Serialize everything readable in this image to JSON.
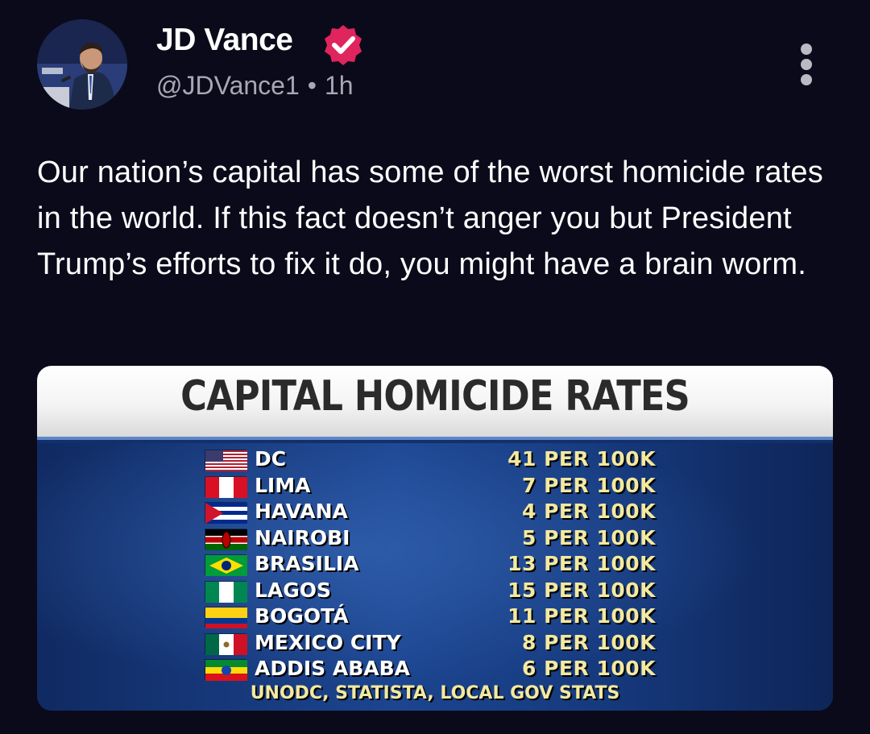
{
  "author": {
    "name": "JD Vance",
    "handle": "@JDVance1",
    "separator": "•",
    "time": "1h",
    "verified_color": "#e0245e"
  },
  "post": {
    "text": "Our nation’s capital has some of the worst homicide rates in the world. If this fact doesn’t anger you but President Trump’s efforts to fix it do, you might have a brain worm."
  },
  "menu_icon": "more-vertical-icon",
  "media": {
    "title": "CAPITAL HOMICIDE RATES",
    "rows": [
      {
        "city": "DC",
        "rate": "41 PER 100K",
        "flag": "flag-usa"
      },
      {
        "city": "LIMA",
        "rate": "7 PER 100K",
        "flag": "flag-peru"
      },
      {
        "city": "HAVANA",
        "rate": "4 PER 100K",
        "flag": "flag-cuba"
      },
      {
        "city": "NAIROBI",
        "rate": "5 PER 100K",
        "flag": "flag-kenya"
      },
      {
        "city": "BRASILIA",
        "rate": "13 PER 100K",
        "flag": "flag-brazil"
      },
      {
        "city": "LAGOS",
        "rate": "15 PER 100K",
        "flag": "flag-nigeria"
      },
      {
        "city": "BOGOTÁ",
        "rate": "11 PER 100K",
        "flag": "flag-colombia"
      },
      {
        "city": "MEXICO CITY",
        "rate": "8 PER 100K",
        "flag": "flag-mexico"
      },
      {
        "city": "ADDIS ABABA",
        "rate": "6 PER 100K",
        "flag": "flag-ethiopia"
      }
    ],
    "source": "UNODC, STATISTA, LOCAL GOV STATS"
  },
  "colors": {
    "background": "#0a0a1a",
    "rate_text": "#f3e9a0",
    "board_blue": "#14306a"
  }
}
